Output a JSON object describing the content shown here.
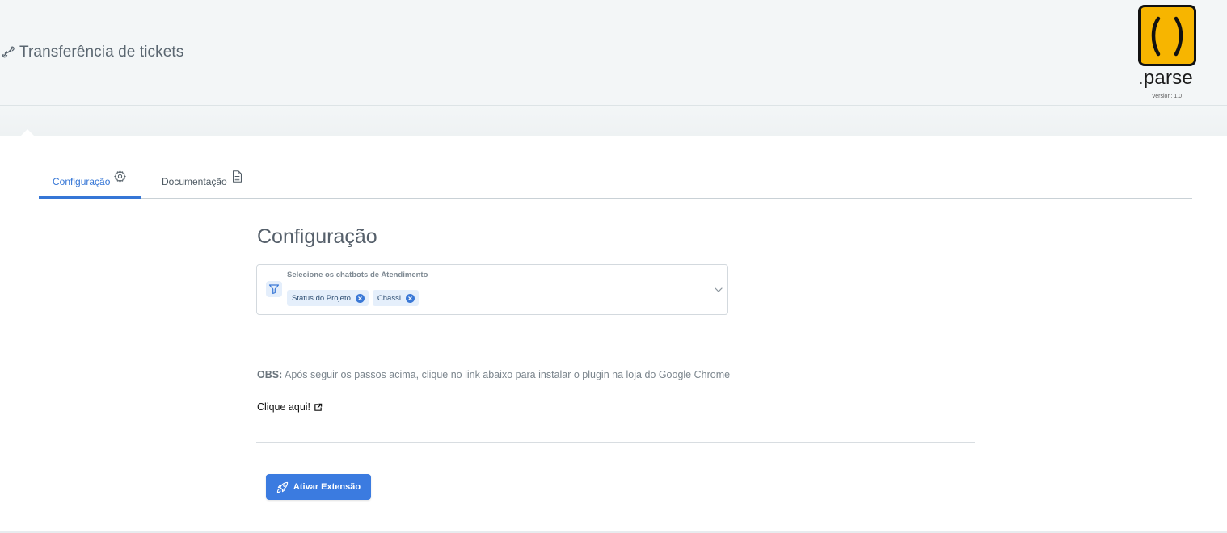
{
  "header": {
    "title": "Transferência de tickets",
    "title_icon": "link-chain-icon",
    "logo": {
      "brand": ".parse",
      "version": "Version: 1.0"
    }
  },
  "tabs": [
    {
      "label": "Configuração",
      "icon": "gear-icon",
      "active": true
    },
    {
      "label": "Documentação",
      "icon": "document-icon",
      "active": false
    }
  ],
  "main": {
    "section_title": "Configuração",
    "chatbot_select": {
      "label": "Selecione os chatbots de Atendimento",
      "icon": "filter-icon",
      "selected": [
        "Status do Projeto",
        "Chassi"
      ]
    },
    "obs": {
      "prefix": "OBS:",
      "text": "Após seguir os passos acima, clique no link abaixo para instalar o plugin na loja do Google Chrome"
    },
    "link_label": "Clique aqui!",
    "activate_button_label": "Ativar Extensão"
  },
  "colors": {
    "accent": "#3b7be0",
    "header_bg": "#f3f6f7",
    "logo_yellow": "#f7b500"
  }
}
